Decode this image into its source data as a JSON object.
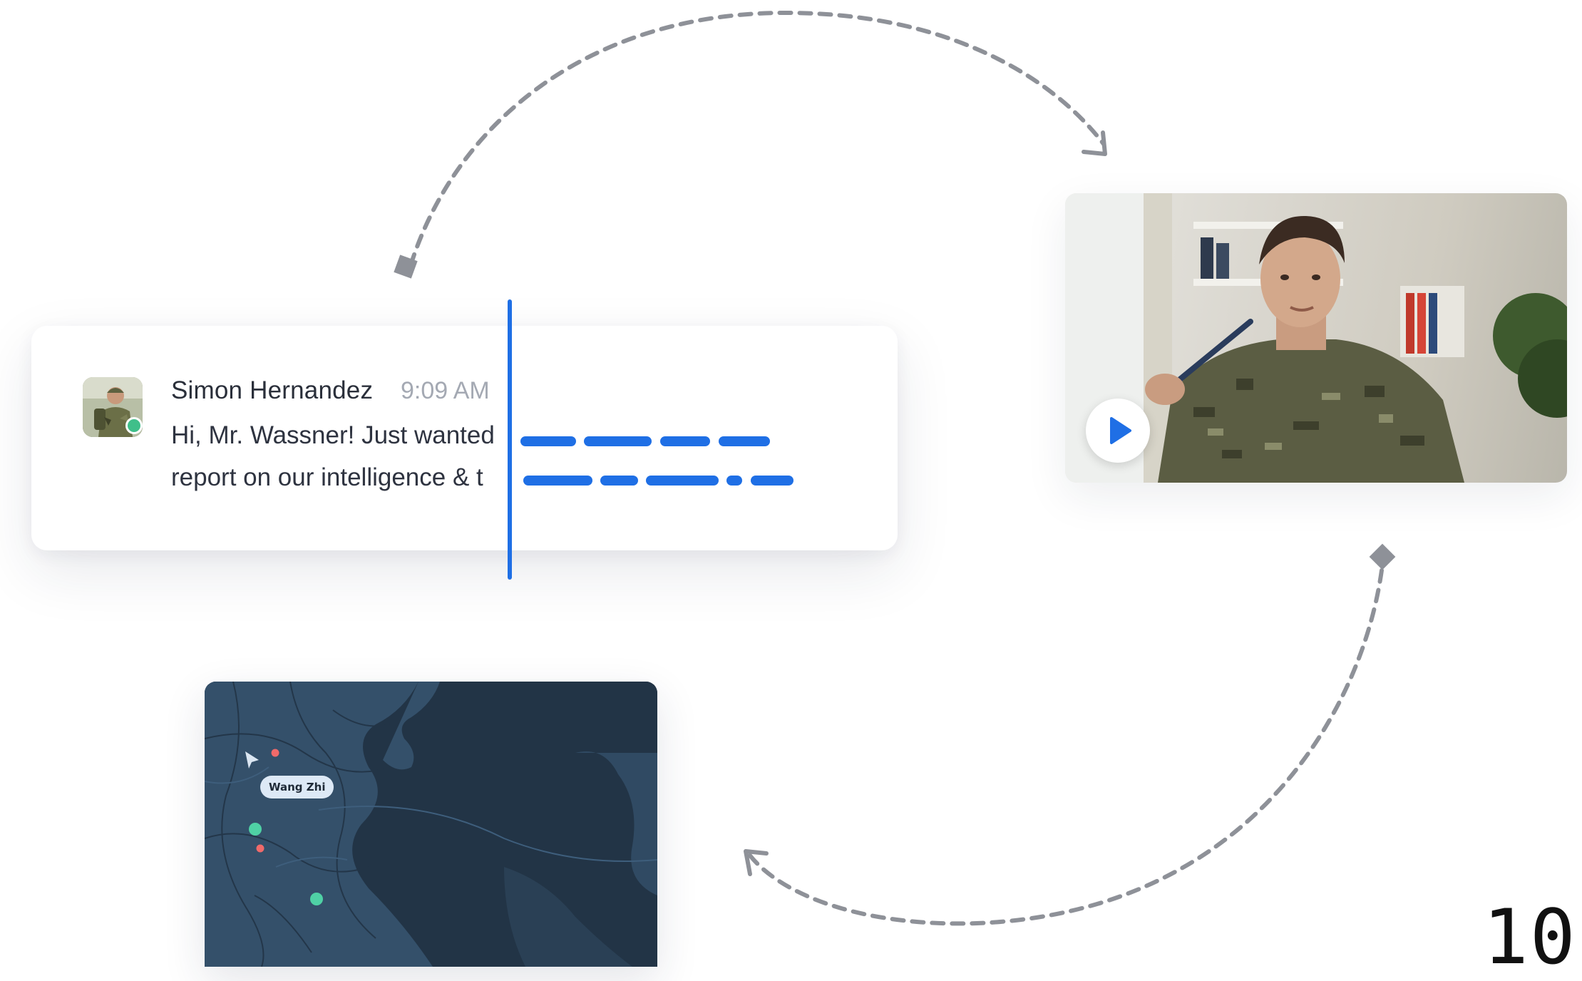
{
  "message": {
    "sender": "Simon Hernandez",
    "time": "9:09 AM",
    "line1": "Hi, Mr. Wassner! Just wanted",
    "line2": "report on our intelligence & t"
  },
  "video": {
    "play_icon": "play-icon"
  },
  "map": {
    "pin_label": "Wang Zhi",
    "cursor_icon": "pointer-arrow-icon"
  },
  "colors": {
    "accent": "#1f6fe5",
    "connector": "#8e9198",
    "online": "#3fbf8a",
    "map_bg": "#233547",
    "map_land": "#34506a",
    "pin_green": "#4fd1a5",
    "pin_red": "#f06a6a"
  },
  "page_number": "10"
}
